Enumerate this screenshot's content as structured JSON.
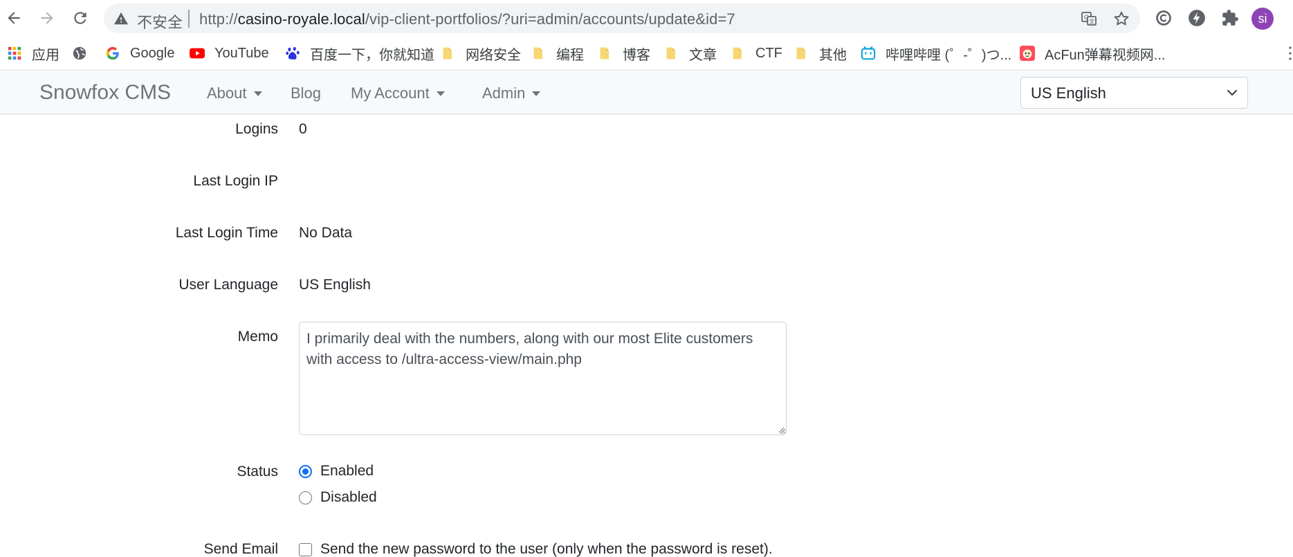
{
  "browser": {
    "insecure_label": "不安全",
    "url": {
      "scheme": "http://",
      "host": "casino-royale.local",
      "path": "/vip-client-portfolios/?uri=admin/accounts/update&id=7"
    },
    "profile_initials": "si"
  },
  "bookmarks": [
    {
      "label": "应用",
      "icon": "apps-grid-icon"
    },
    {
      "label": "",
      "icon": "globe-icon"
    },
    {
      "label": "Google",
      "icon": "google-icon"
    },
    {
      "label": "YouTube",
      "icon": "youtube-icon"
    },
    {
      "label": "百度一下，你就知道",
      "icon": "baidu-icon"
    },
    {
      "label": "网络安全",
      "icon": "folder-icon"
    },
    {
      "label": "编程",
      "icon": "folder-icon"
    },
    {
      "label": "博客",
      "icon": "folder-icon"
    },
    {
      "label": "文章",
      "icon": "folder-icon"
    },
    {
      "label": "CTF",
      "icon": "folder-icon"
    },
    {
      "label": "其他",
      "icon": "folder-icon"
    },
    {
      "label": "哔哩哔哩 (゜-゜)つ...",
      "icon": "bilibili-icon"
    },
    {
      "label": "AcFun弹幕视频网...",
      "icon": "acfun-icon"
    }
  ],
  "navbar": {
    "brand": "Snowfox CMS",
    "links": {
      "about": "About",
      "blog": "Blog",
      "my_account": "My Account",
      "admin": "Admin"
    },
    "language_selected": "US English"
  },
  "form": {
    "logins": {
      "label": "Logins",
      "value": "0"
    },
    "last_login_ip": {
      "label": "Last Login IP",
      "value": ""
    },
    "last_login_time": {
      "label": "Last Login Time",
      "value": "No Data"
    },
    "user_language": {
      "label": "User Language",
      "value": "US English"
    },
    "memo": {
      "label": "Memo",
      "value": "I primarily deal with the numbers, along with our most Elite customers with access to /ultra-access-view/main.php"
    },
    "status": {
      "label": "Status",
      "options": [
        "Enabled",
        "Disabled"
      ],
      "selected": "Enabled"
    },
    "send_email": {
      "label": "Send Email",
      "checkbox_label": "Send the new password to the user (only when the password is reset).",
      "checked": false
    }
  },
  "colors": {
    "accent": "#0d6efd",
    "navbar_bg": "#f8f9fa",
    "muted_text": "#6c757d",
    "avatar": "#8e44b5"
  }
}
